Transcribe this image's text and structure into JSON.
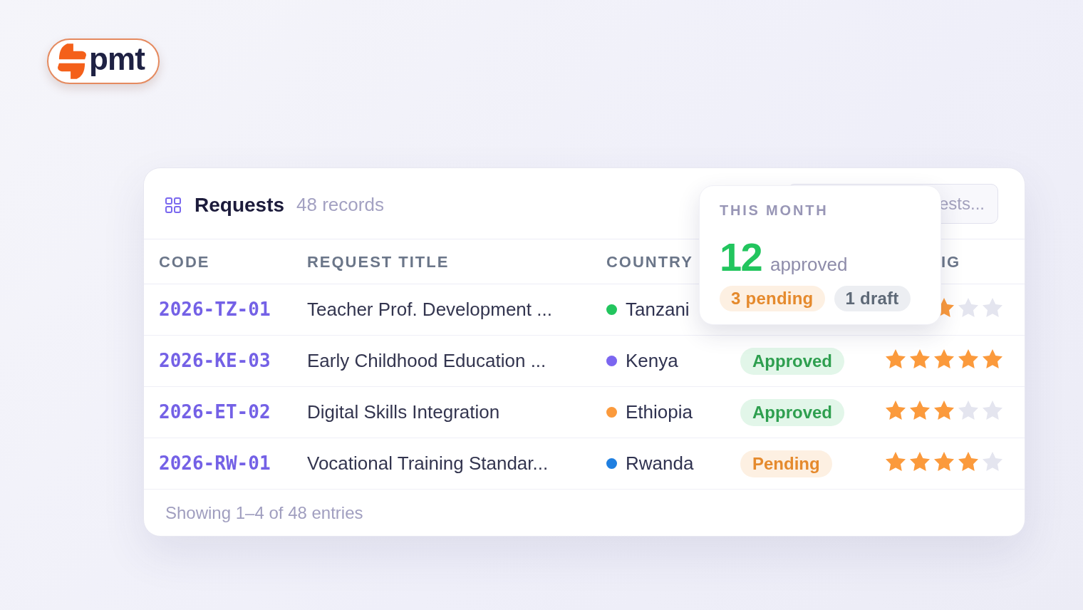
{
  "logo": {
    "text": "pmt"
  },
  "panel": {
    "title": "Requests",
    "count": "48 records",
    "search": {
      "placeholder": "ests..."
    }
  },
  "table": {
    "columns": {
      "code": "CODE",
      "request_title": "REQUEST TITLE",
      "country": "COUNTRY",
      "column_5": "IG"
    },
    "rows": [
      {
        "code": "2026-TZ-01",
        "title": "Teacher Prof. Development ...",
        "country": "Tanzani",
        "color": "#22c55e",
        "rating": {
          "kind": "partial",
          "stars": 1
        }
      },
      {
        "code": "2026-KE-03",
        "title": "Early Childhood Education ...",
        "country": "Kenya",
        "color": "#7b66f0",
        "status": {
          "label": "Approved",
          "kind": "approved"
        },
        "rating": {
          "kind": "full",
          "stars": 5
        }
      },
      {
        "code": "2026-ET-02",
        "title": "Digital Skills Integration",
        "country": "Ethiopia",
        "color": "#fb9a3c",
        "status": {
          "label": "Approved",
          "kind": "approved"
        },
        "rating": {
          "kind": "full",
          "stars": 3
        }
      },
      {
        "code": "2026-RW-01",
        "title": "Vocational Training Standar...",
        "country": "Rwanda",
        "color": "#1f7fe0",
        "status": {
          "label": "Pending",
          "kind": "pending"
        },
        "rating": {
          "kind": "full",
          "stars": 4
        }
      }
    ]
  },
  "footer": {
    "text": "Showing 1–4 of 48 entries"
  },
  "summary_popover": {
    "heading": "THIS MONTH",
    "value": "12",
    "value_label": "approved",
    "badges": [
      {
        "label": "3 pending",
        "kind": "pending"
      },
      {
        "label": "1 draft",
        "kind": "draft"
      }
    ]
  }
}
